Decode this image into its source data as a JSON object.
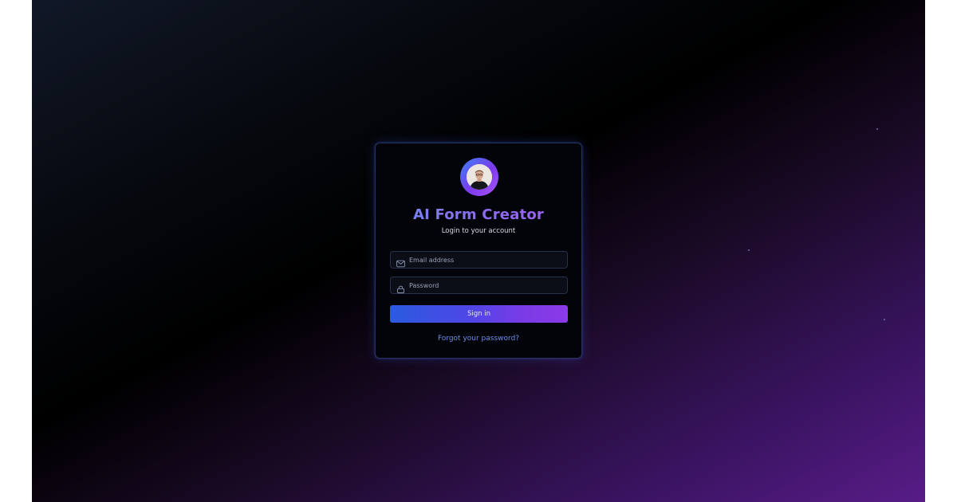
{
  "app": {
    "title": "AI Form Creator",
    "subtitle": "Login to your account"
  },
  "form": {
    "email": {
      "value": "",
      "placeholder": "Email address",
      "icon": "mail-icon"
    },
    "password": {
      "value": "",
      "placeholder": "Password",
      "icon": "lock-icon"
    },
    "submit_label": "Sign in",
    "forgot_label": "Forgot your password?"
  },
  "avatar": {
    "icon": "user-avatar"
  },
  "colors": {
    "accent_blue": "#3b82f6",
    "accent_purple": "#8b3ae8",
    "link": "#6d8fe8",
    "card_border": "#23305c"
  }
}
